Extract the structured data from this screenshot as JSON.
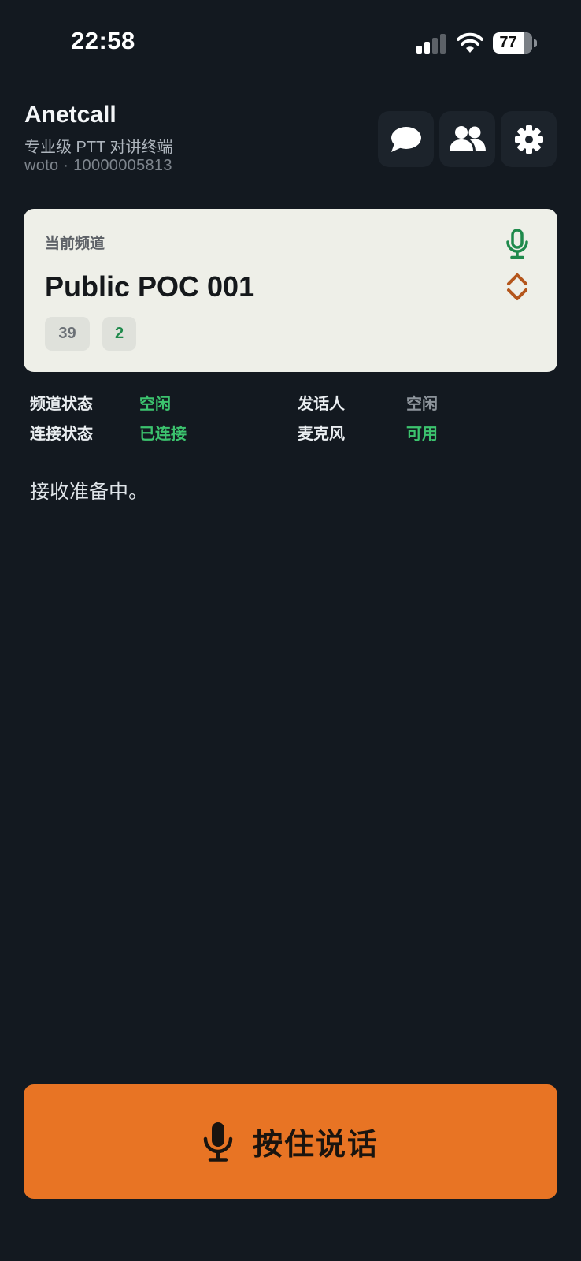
{
  "status_bar": {
    "time": "22:58",
    "battery": "77",
    "signal_icon": "cellular-signal-icon",
    "wifi_icon": "wifi-icon"
  },
  "header": {
    "title": "Anetcall",
    "subtitle": "专业级 PTT 对讲终端",
    "account": "woto · 10000005813",
    "buttons": [
      {
        "icon": "chat-bubble-icon"
      },
      {
        "icon": "users-icon"
      },
      {
        "icon": "gear-icon"
      }
    ]
  },
  "channel": {
    "label": "当前频道",
    "name": "Public POC 001",
    "total_members": "39",
    "online_members": "2",
    "mic_icon": "microphone-icon",
    "switch_icon": "chevron-up-down-icon"
  },
  "stats": {
    "channel_state_label": "频道状态",
    "channel_state_value": "空闲",
    "speaker_label": "发话人",
    "speaker_value": "空闲",
    "connection_label": "连接状态",
    "connection_value": "已连接",
    "mic_label": "麦克风",
    "mic_value": "可用"
  },
  "message": "接收准备中。",
  "ptt": {
    "label": "按住说话",
    "icon": "microphone-icon"
  },
  "colors": {
    "background": "#131920",
    "card": "#eeefe8",
    "accent_orange": "#e87424",
    "status_green": "#3cc36e",
    "mic_green": "#1f8a4c",
    "switch_brown": "#b4561c"
  }
}
